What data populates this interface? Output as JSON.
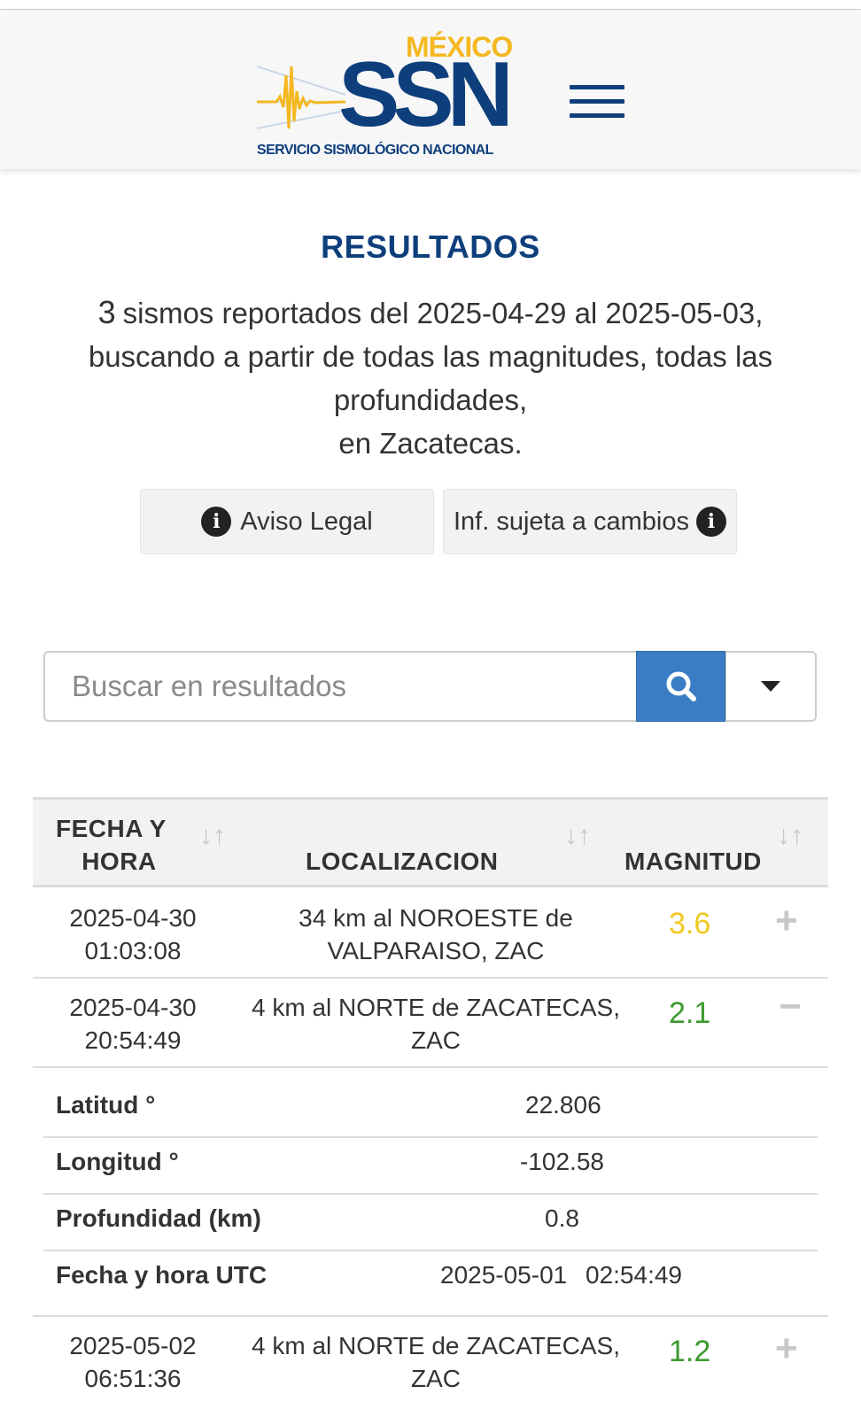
{
  "header": {
    "logo": {
      "country": "MÉXICO",
      "acronym": "SSN",
      "subtitle": "SERVICIO SISMOLÓGICO NACIONAL"
    },
    "menu_icon": "hamburger-menu-icon"
  },
  "results": {
    "title": "RESULTADOS",
    "count": "3",
    "summary_line1": "sismos reportados del 2025-04-29 al 2025-05-03,",
    "summary_line2": "buscando a partir de todas las magnitudes, todas las profundidades,",
    "summary_line3": "en Zacatecas."
  },
  "buttons": {
    "legal": "Aviso Legal",
    "changes": "Inf. sujeta a cambios",
    "info_glyph": "i"
  },
  "search": {
    "placeholder": "Buscar en resultados",
    "search_icon": "search-icon",
    "dropdown_icon": "caret-down-icon"
  },
  "table": {
    "headers": {
      "date_line1": "FECHA Y",
      "date_line2": "HORA",
      "location": "LOCALIZACION",
      "magnitude": "MAGNITUD"
    },
    "sort_glyph": "↓↑",
    "rows": [
      {
        "date": "2025-04-30",
        "time": "01:03:08",
        "loc_line1": "34 km al NOROESTE de",
        "loc_line2": "VALPARAISO, ZAC",
        "magnitude": "3.6",
        "mag_color": "#f2c81e",
        "toggle": "+"
      },
      {
        "date": "2025-04-30",
        "time": "20:54:49",
        "loc_line1": "4 km al NORTE de ZACATECAS,",
        "loc_line2": "ZAC",
        "magnitude": "2.1",
        "mag_color": "#3a9a2e",
        "toggle": "−"
      },
      {
        "date": "2025-05-02",
        "time": "06:51:36",
        "loc_line1": "4 km al NORTE de ZACATECAS,",
        "loc_line2": "ZAC",
        "magnitude": "1.2",
        "mag_color": "#3a9a2e",
        "toggle": "+"
      }
    ],
    "details": {
      "lat_label": "Latitud °",
      "lat_value": "22.806",
      "lon_label": "Longitud °",
      "lon_value": "-102.58",
      "depth_label": "Profundidad (km)",
      "depth_value": "0.8",
      "utc_label": "Fecha y hora UTC",
      "utc_date": "2025-05-01",
      "utc_time": "02:54:49"
    }
  },
  "colors": {
    "brand_blue": "#0e3f7c",
    "brand_yellow": "#f5b820",
    "search_button": "#3a7dc4"
  }
}
